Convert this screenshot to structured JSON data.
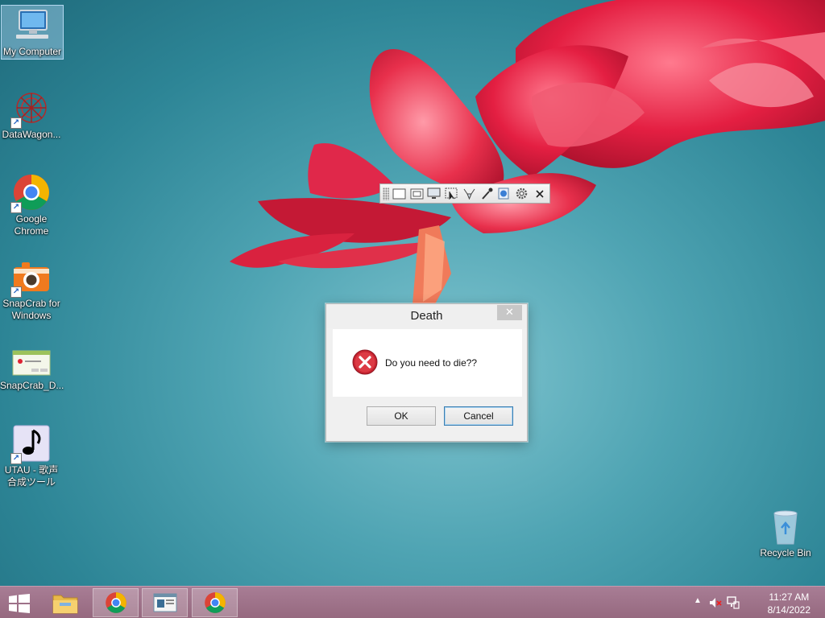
{
  "desktop": {
    "icons": [
      {
        "label": "My Computer",
        "icon": "computer-icon"
      },
      {
        "label": "DataWagon...",
        "icon": "datawagon-icon"
      },
      {
        "label": "Google Chrome",
        "icon": "chrome-icon"
      },
      {
        "label": "SnapCrab for Windows",
        "icon": "camera-icon"
      },
      {
        "label": "SnapCrab_D...",
        "icon": "window-thumbnail-icon"
      },
      {
        "label": "UTAU - 歌声合成ツール",
        "icon": "music-note-icon"
      },
      {
        "label": "Recycle Bin",
        "icon": "recycle-bin-icon"
      }
    ]
  },
  "snap_toolbar": {
    "buttons": [
      "full-screen-icon",
      "window-icon",
      "monitor-icon",
      "region-select-icon",
      "web-page-icon",
      "eyedropper-icon",
      "globe-icon",
      "gear-icon",
      "close-icon"
    ]
  },
  "dialog": {
    "title": "Death",
    "close_glyph": "✕",
    "message": "Do you need to die??",
    "icon": "error-icon",
    "ok_label": "OK",
    "cancel_label": "Cancel"
  },
  "taskbar": {
    "items": [
      "start-icon",
      "file-explorer-icon",
      "chrome-icon",
      "app-window-icon",
      "chrome-icon"
    ],
    "tray": {
      "show_hidden_glyph": "▲",
      "time": "11:27 AM",
      "date": "8/14/2022"
    }
  },
  "colors": {
    "taskbar": "#a07389",
    "error_red": "#d9232e",
    "wallpaper_teal": "#3a94a5",
    "flower_red": "#e0203c"
  }
}
